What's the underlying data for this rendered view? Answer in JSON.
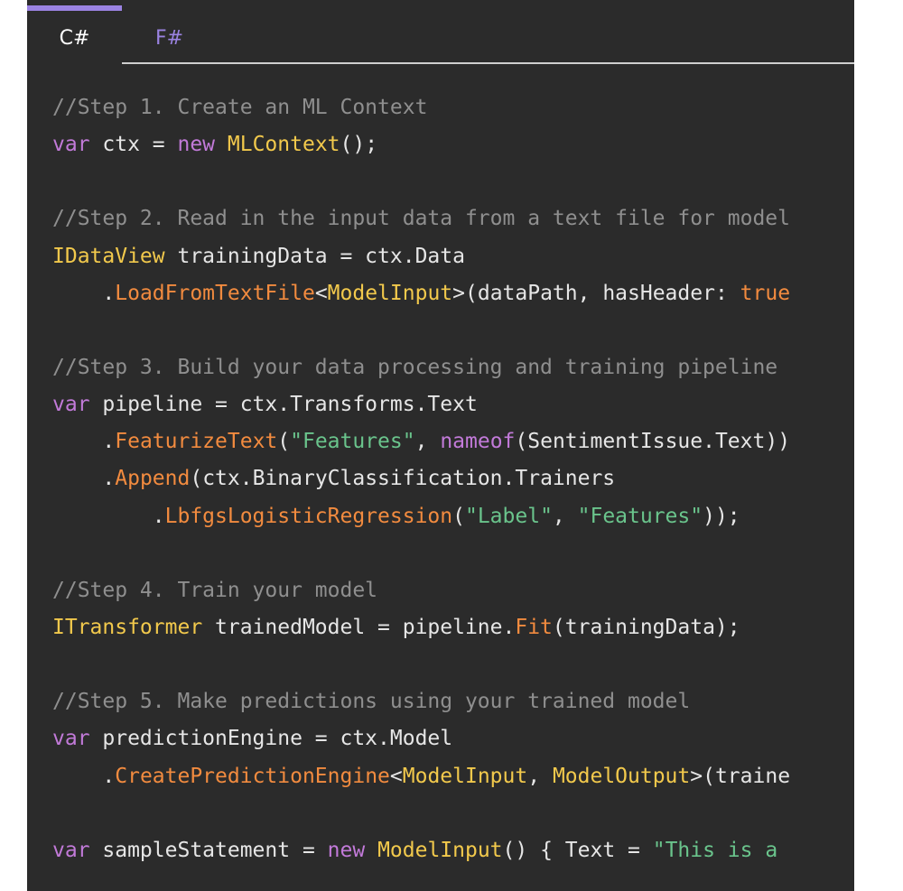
{
  "tabs": [
    {
      "label": "C#",
      "active": true
    },
    {
      "label": "F#",
      "active": false
    }
  ],
  "colors": {
    "background": "#2b2b2b",
    "tab_accent": "#9b83e2",
    "comment": "#8f8f8f",
    "keyword": "#c27ad9",
    "type": "#f2c94c",
    "method": "#f28b3f",
    "string": "#6ac48c",
    "plain": "#e6e6e6"
  },
  "code": {
    "comment1": "//Step 1. Create an ML Context",
    "l1": {
      "kw": "var",
      "plain1": " ctx = ",
      "kw2": "new",
      "sp": " ",
      "type": "MLContext",
      "plain2": "();"
    },
    "comment2": "//Step 2. Read in the input data from a text file for model",
    "l2": {
      "type": "IDataView",
      "plain": " trainingData = ctx.Data"
    },
    "l3": {
      "indent": "    .",
      "fn": "LoadFromTextFile",
      "lt": "<",
      "type": "ModelInput",
      "plain": ">(dataPath, hasHeader: ",
      "val": "true"
    },
    "comment3": "//Step 3. Build your data processing and training pipeline",
    "l4": {
      "kw": "var",
      "plain": " pipeline = ctx.Transforms.Text"
    },
    "l5": {
      "indent": "    .",
      "fn": "FeaturizeText",
      "p1": "(",
      "str": "\"Features\"",
      "p2": ", ",
      "kw": "nameof",
      "p3": "(SentimentIssue.Text))"
    },
    "l6": {
      "indent": "    .",
      "fn": "Append",
      "plain": "(ctx.BinaryClassification.Trainers"
    },
    "l7": {
      "indent": "        .",
      "fn": "LbfgsLogisticRegression",
      "p1": "(",
      "str1": "\"Label\"",
      "p2": ", ",
      "str2": "\"Features\"",
      "p3": "));"
    },
    "comment4": "//Step 4. Train your model",
    "l8": {
      "type": "ITransformer",
      "plain1": " trainedModel = pipeline.",
      "fn": "Fit",
      "plain2": "(trainingData);"
    },
    "comment5": "//Step 5. Make predictions using your trained model",
    "l9": {
      "kw": "var",
      "plain": " predictionEngine = ctx.Model"
    },
    "l10": {
      "indent": "    .",
      "fn": "CreatePredictionEngine",
      "lt": "<",
      "type1": "ModelInput",
      "p1": ", ",
      "type2": "ModelOutput",
      "p2": ">(traine"
    },
    "l11": {
      "kw": "var",
      "plain1": " sampleStatement = ",
      "kw2": "new",
      "sp": " ",
      "type": "ModelInput",
      "plain2": "() { Text = ",
      "str": "\"This is a"
    }
  }
}
